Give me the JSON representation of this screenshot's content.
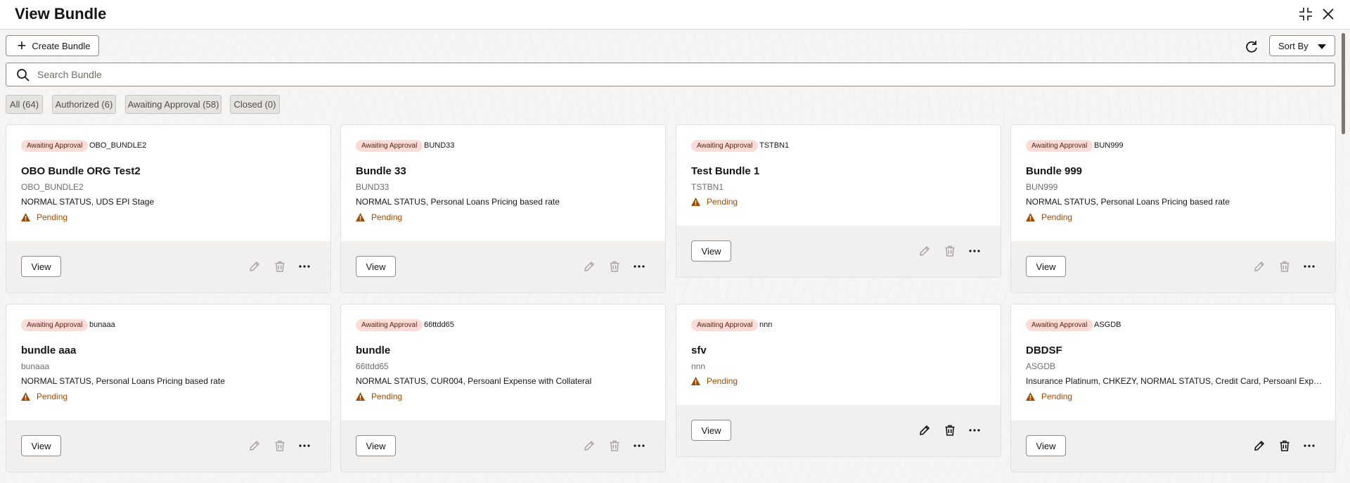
{
  "header": {
    "title": "View Bundle"
  },
  "toolbar": {
    "create_label": "Create Bundle",
    "sort_label": "Sort By"
  },
  "search": {
    "placeholder": "Search Bundle"
  },
  "filters": [
    {
      "label": "All (64)"
    },
    {
      "label": "Authorized (6)"
    },
    {
      "label": "Awaiting Approval (58)"
    },
    {
      "label": "Closed (0)"
    }
  ],
  "colors": {
    "badge_bg": "#fbdcd7",
    "pending": "#a04a00",
    "footer_bg": "#f1f0ee"
  },
  "cards": [
    {
      "badge": "Awaiting Approval",
      "code": "OBO_BUNDLE2",
      "title": "OBO Bundle ORG Test2",
      "subtitle": "OBO_BUNDLE2",
      "description": "NORMAL STATUS, UDS EPI Stage",
      "status": "Pending",
      "view_label": "View",
      "actions_enabled": false
    },
    {
      "badge": "Awaiting Approval",
      "code": "BUND33",
      "title": "Bundle 33",
      "subtitle": "BUND33",
      "description": "NORMAL STATUS, Personal Loans Pricing based rate",
      "status": "Pending",
      "view_label": "View",
      "actions_enabled": false
    },
    {
      "badge": "Awaiting Approval",
      "code": "TSTBN1",
      "title": "Test Bundle 1",
      "subtitle": "TSTBN1",
      "description": "",
      "status": "Pending",
      "view_label": "View",
      "actions_enabled": false
    },
    {
      "badge": "Awaiting Approval",
      "code": "BUN999",
      "title": "Bundle 999",
      "subtitle": "BUN999",
      "description": "NORMAL STATUS, Personal Loans Pricing based rate",
      "status": "Pending",
      "view_label": "View",
      "actions_enabled": false
    },
    {
      "badge": "Awaiting Approval",
      "code": "bunaaa",
      "title": "bundle aaa",
      "subtitle": "bunaaa",
      "description": "NORMAL STATUS, Personal Loans Pricing based rate",
      "status": "Pending",
      "view_label": "View",
      "actions_enabled": false
    },
    {
      "badge": "Awaiting Approval",
      "code": "66ttdd65",
      "title": "bundle",
      "subtitle": "66ttdd65",
      "description": "NORMAL STATUS, CUR004, Persoanl Expense with Collateral",
      "status": "Pending",
      "view_label": "View",
      "actions_enabled": false
    },
    {
      "badge": "Awaiting Approval",
      "code": "nnn",
      "title": "sfv",
      "subtitle": "nnn",
      "description": "",
      "status": "Pending",
      "view_label": "View",
      "actions_enabled": true
    },
    {
      "badge": "Awaiting Approval",
      "code": "ASGDB",
      "title": "DBDSF",
      "subtitle": "ASGDB",
      "description": "Insurance Platinum, CHKEZY, NORMAL STATUS, Credit Card, Persoanl Expense with Collateral",
      "status": "Pending",
      "view_label": "View",
      "actions_enabled": true
    }
  ]
}
